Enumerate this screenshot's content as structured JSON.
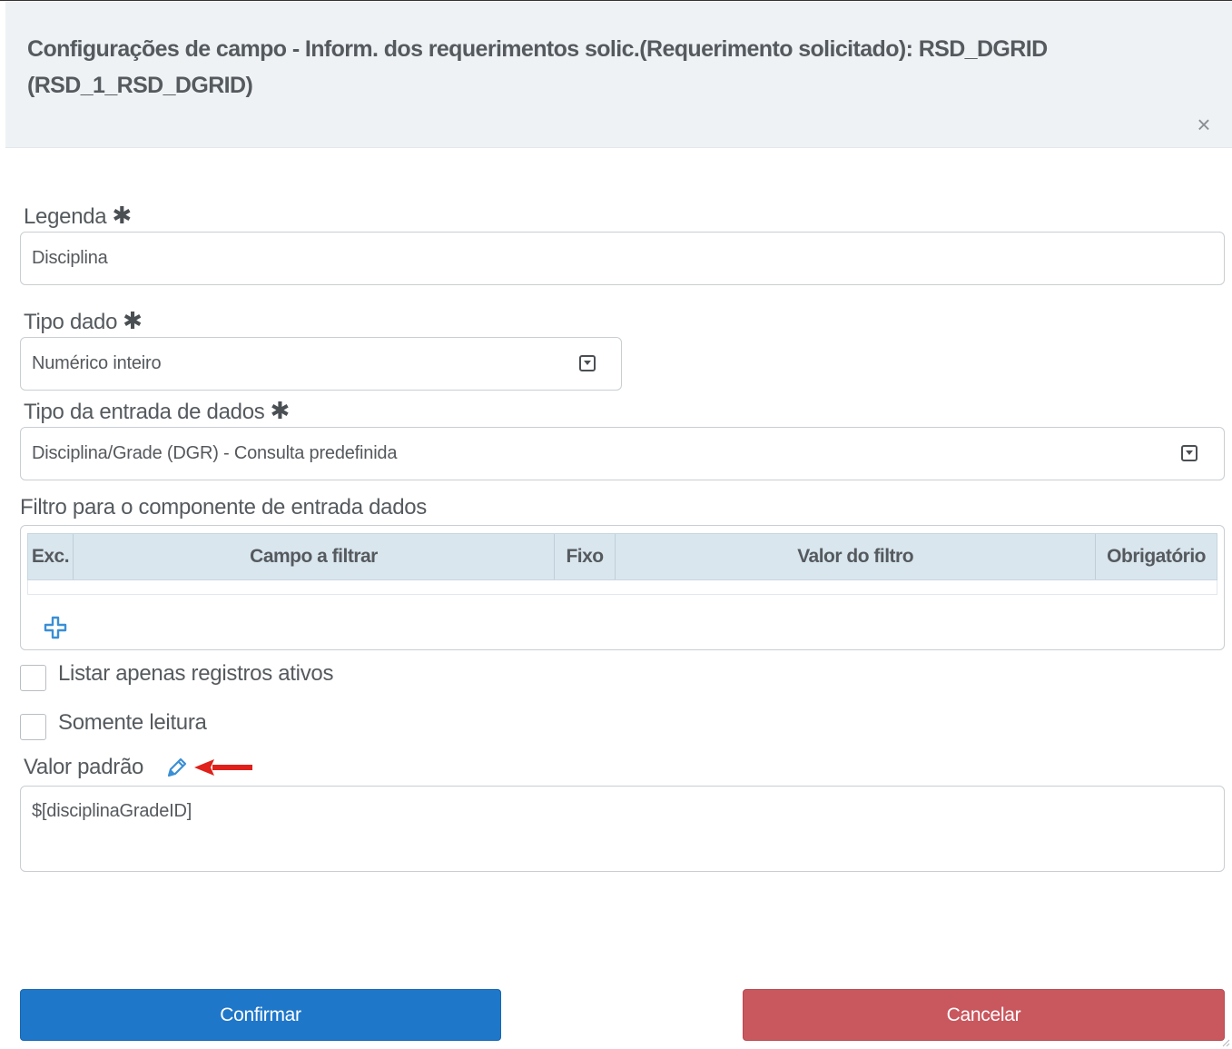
{
  "dialog": {
    "title": "Configurações de campo - Inform. dos requerimentos solic.(Requerimento solicitado): RSD_DGRID (RSD_1_RSD_DGRID)",
    "close_glyph": "×"
  },
  "fields": {
    "legenda": {
      "label": "Legenda",
      "required_marker": "✱",
      "value": "Disciplina"
    },
    "tipo_dado": {
      "label": "Tipo dado",
      "required_marker": "✱",
      "value": "Numérico inteiro"
    },
    "tipo_entrada": {
      "label": "Tipo da entrada de dados",
      "required_marker": "✱",
      "value": "Disciplina/Grade (DGR) - Consulta predefinida"
    },
    "filtro": {
      "label": "Filtro para o componente de entrada dados",
      "columns": [
        "Exc.",
        "Campo a filtrar",
        "Fixo",
        "Valor do filtro",
        "Obrigatório"
      ],
      "rows": []
    },
    "listar_ativos": {
      "label": "Listar apenas registros ativos",
      "checked": false
    },
    "somente_leitura": {
      "label": "Somente leitura",
      "checked": false
    },
    "valor_padrao": {
      "label": "Valor padrão",
      "value": "$[disciplinaGradeID]"
    }
  },
  "buttons": {
    "confirm": "Confirmar",
    "cancel": "Cancelar"
  },
  "icons": {
    "close": "close-icon",
    "select": "dropdown-caret-icon",
    "add": "plus-icon",
    "edit": "pencil-icon",
    "annotation": "red-arrow-icon"
  },
  "colors": {
    "header_bg": "#eef2f5",
    "grid_header_bg": "#d9e6ee",
    "confirm_bg": "#1f77c9",
    "cancel_bg": "#c9575e",
    "accent_icon": "#3a8fd6",
    "annotation_arrow": "#e0201a"
  }
}
